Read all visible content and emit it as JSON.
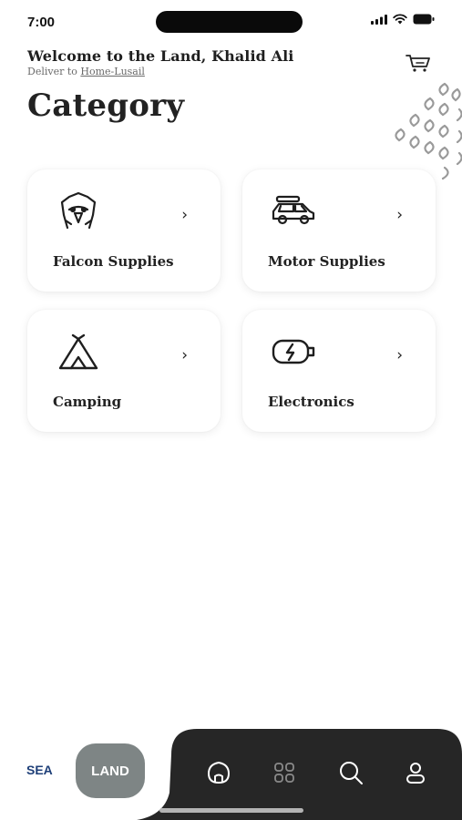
{
  "status_bar": {
    "time": "7:00"
  },
  "header": {
    "welcome": "Welcome to the Land, Khalid Ali",
    "deliver_prefix": "Deliver to",
    "deliver_location": "Home-Lusail",
    "cart_icon": "cart-icon"
  },
  "page": {
    "title": "Category"
  },
  "categories": [
    {
      "label": "Falcon Supplies",
      "icon": "falcon-icon"
    },
    {
      "label": "Motor Supplies",
      "icon": "car-icon"
    },
    {
      "label": "Camping",
      "icon": "tent-icon"
    },
    {
      "label": "Electronics",
      "icon": "battery-charging-icon"
    }
  ],
  "mode_switch": {
    "sea_label": "SEA",
    "land_label": "LAND",
    "active": "LAND"
  },
  "bottom_nav": {
    "items": [
      "home-icon",
      "grid-icon",
      "search-icon",
      "profile-icon"
    ]
  },
  "colors": {
    "nav_background": "#262626",
    "land_active": "#7e8585",
    "sea_text": "#1e3f78",
    "nav_icon_active": "#ffffff",
    "nav_icon_inactive": "#8a8a8a"
  }
}
